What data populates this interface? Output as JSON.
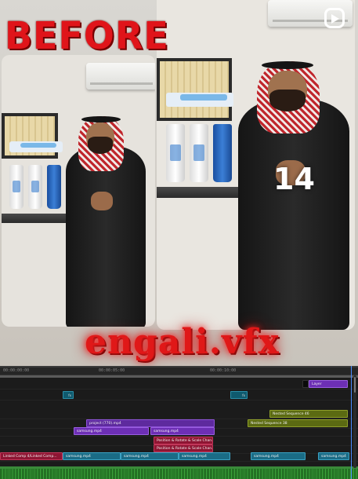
{
  "overlay": {
    "before_title": "BEFORE",
    "counter": "14",
    "brand": "engali.vfx"
  },
  "icons": {
    "instagram_reel": "reel-play-icon"
  },
  "colors": {
    "title_red": "#e0141a",
    "clip_purple": "#6d2fb5",
    "clip_olive": "#5b6a12",
    "clip_crimson": "#8e1533",
    "clip_teal": "#0f5a6e",
    "audio_green": "#2f8c2f"
  },
  "timeline": {
    "ruler": [
      "00:00:00:00",
      "00:00:05:00",
      "00:00:10:00"
    ],
    "clips": {
      "layer": "Layer",
      "nested_seq_46": "Nested Sequence 46",
      "nested_seq_38": "Nested Sequence 38",
      "project_770": "project (770).mp4",
      "samsung_a": "samsung.mp4",
      "samsung_b": "samsung.mp4",
      "position_1": "Position & Rotate & Scale Chan...",
      "position_2": "Position & Rotate & Scale Chan...",
      "linked_comp": "Linked Comp 4/Linked Comp...",
      "a_samsung_1": "samsung.mp4",
      "a_samsung_2": "samsung.mp4",
      "a_samsung_3": "samsung.mp4",
      "a_samsung_4": "samsung.mp4",
      "a_samsung_5": "samsung.mp4",
      "fx_badge": "fx"
    }
  }
}
